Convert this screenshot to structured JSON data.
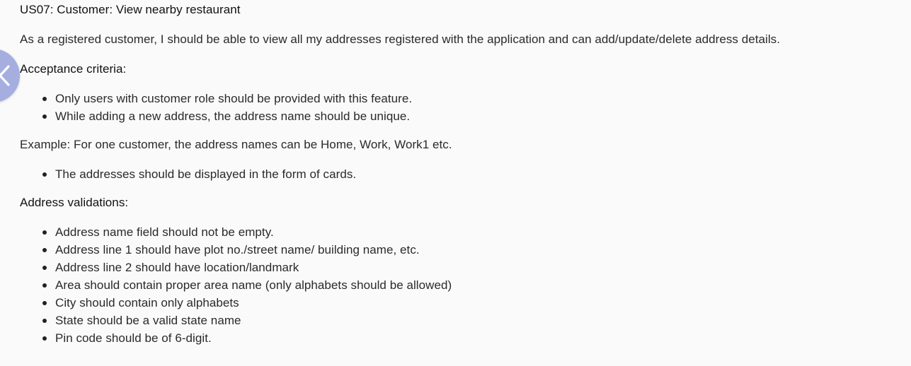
{
  "story": {
    "title": "US07: Customer: View nearby restaurant",
    "description": "As a registered customer, I should be able to view all my addresses registered with the application and can add/update/delete address details.",
    "acceptance_heading": "Acceptance criteria:",
    "acceptance_items": [
      "Only users with customer role should be provided with this feature.",
      "While adding a new address, the address name should be unique."
    ],
    "example": "Example: For one customer, the address names can be Home, Work, Work1 etc.",
    "example_items": [
      "The addresses should be displayed in the form of cards."
    ],
    "validations_heading": "Address validations:",
    "validation_items": [
      "Address name field should not be empty.",
      "Address line 1 should have plot no./street name/ building name, etc.",
      "Address line 2 should have location/landmark",
      "Area should contain proper area name (only alphabets should be allowed)",
      "City should contain only alphabets",
      "State should be a valid state name",
      "Pin code should be of 6-digit."
    ]
  },
  "nav": {
    "back_icon": "chevron-left-icon",
    "fab_color": "#a5aedf"
  }
}
